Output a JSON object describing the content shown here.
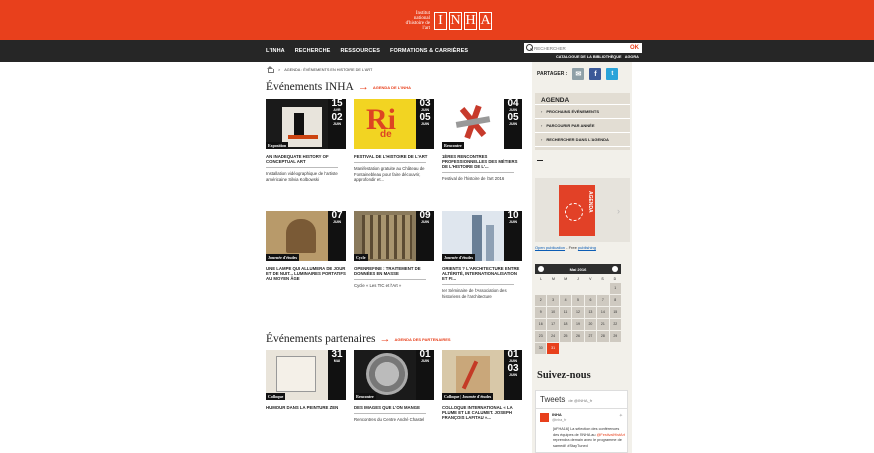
{
  "header": {
    "logo_small": "Institut national d'histoire de l'art",
    "logo_letters": [
      "I",
      "N",
      "H",
      "A"
    ]
  },
  "nav": {
    "items": [
      "L'INHA",
      "RECHERCHE",
      "RESSOURCES",
      "FORMATIONS & CARRIÈRES"
    ],
    "search_placeholder": "RECHERCHER",
    "search_ok": "OK",
    "catalog": "CATALOGUE DE LA BIBLIOTHÈQUE",
    "agora": "AGORA"
  },
  "breadcrumb": "AGENDA : ÉVÉNEMENTS EN HISTOIRE DE L'ART",
  "share_label": "PARTAGER :",
  "inha_section": {
    "title": "Événements INHA",
    "link": "AGENDA DE L'INHA",
    "cards": [
      {
        "d1": "15",
        "m1": "AVR",
        "d2": "02",
        "m2": "JUIN",
        "cat": "Exposition",
        "title": "AN INADEQUATE HISTORY OF CONCEPTUAL ART",
        "desc": "Installation vidéographique de l'artiste américaine Silvia Kolbowski"
      },
      {
        "d1": "03",
        "m1": "JUIN",
        "d2": "05",
        "m2": "JUIN",
        "cat": "",
        "title": "FESTIVAL DE L'HISTOIRE DE L'ART",
        "desc": "Manifestation gratuite au Château de Fontainebleau pour faire découvrir, approfondir et..."
      },
      {
        "d1": "04",
        "m1": "JUIN",
        "d2": "05",
        "m2": "JUIN",
        "cat": "Rencontre",
        "title": "1ÈRES RENCONTRES PROFESSIONNELLES DES MÉTIERS DE L'HISTOIRE DE L'...",
        "desc": "Festival de l'histoire de l'art 2016"
      },
      {
        "d1": "07",
        "m1": "JUIN",
        "d2": "",
        "m2": "",
        "cat": "Journée d'études",
        "title": "UNE LAMPE QUI ALLUMERA DE JOUR ET DE NUIT... LUMINAIRES PORTATIFS AU MOYEN ÂGE",
        "desc": ""
      },
      {
        "d1": "09",
        "m1": "JUIN",
        "d2": "",
        "m2": "",
        "cat": "Cycle",
        "title": "OPENREFINE : TRAITEMENT DE DONNÉES EN MASSE",
        "desc": "Cycle « Les TIC et l'Art »"
      },
      {
        "d1": "10",
        "m1": "JUIN",
        "d2": "",
        "m2": "",
        "cat": "Journée d'études",
        "title": "ORIENTS ? L'ARCHITECTURE ENTRE ALTÉRITÉ, INTERNATIONALISATION ET FI...",
        "desc": "Ier Séminaire de l'Association des historiens de l'architecture"
      }
    ]
  },
  "partner_section": {
    "title": "Événements partenaires",
    "link": "AGENDA DES PARTENAIRES",
    "cards": [
      {
        "d1": "31",
        "m1": "MAI",
        "d2": "",
        "m2": "",
        "cat": "Colloque",
        "title": "HUMOUR DANS LA PEINTURE ZEN",
        "desc": ""
      },
      {
        "d1": "01",
        "m1": "JUIN",
        "d2": "",
        "m2": "",
        "cat": "Rencontre",
        "title": "DES IMAGES QUE L'ON MANGE",
        "desc": "Rencontres du Centre André Chastel"
      },
      {
        "d1": "01",
        "m1": "JUIN",
        "d2": "03",
        "m2": "JUIN",
        "cat": "Colloque | Journée d'études",
        "title": "COLLOQUE INTERNATIONAL « LA PLUME ET LE CALUMET. JOSEPH FRANÇOIS LAFITAU »...",
        "desc": ""
      }
    ]
  },
  "agenda_box": {
    "title": "AGENDA",
    "items": [
      "PROCHAINS ÉVÉNEMENTS",
      "PARCOURIR PAR ANNÉE",
      "RECHERCHER DANS L'AGENDA"
    ]
  },
  "publication": {
    "cover_text": "AGENDA",
    "link_text": "Open publication",
    "free_text": " - Free ",
    "pub_link": "publishing"
  },
  "calendar": {
    "month": "Mai 2016",
    "dow": [
      "L",
      "M",
      "M",
      "J",
      "V",
      "S",
      "D"
    ],
    "days": [
      "",
      "",
      "",
      "",
      "",
      "",
      "1",
      "2",
      "3",
      "4",
      "5",
      "6",
      "7",
      "8",
      "9",
      "10",
      "11",
      "12",
      "13",
      "14",
      "15",
      "16",
      "17",
      "18",
      "19",
      "20",
      "21",
      "22",
      "23",
      "24",
      "25",
      "26",
      "27",
      "28",
      "29",
      "30",
      "31"
    ],
    "today": "31"
  },
  "follow": {
    "title": "Suivez-nous",
    "tweets_title": "Tweets",
    "tweets_by": "de @INHA_fr",
    "user": "INHA",
    "handle": "@inha_fr",
    "tweet_pre": "[#FHA16] La sélection des conférences des équipes de l'INHA au ",
    "tweet_hl": "@FestivalHistArt",
    "tweet_post": " reprendra demain avec le programme de samedi! #StayTuned"
  },
  "colors": {
    "accent": "#e8401c",
    "nav": "#262626",
    "agenda_bg": "#e2ddd3",
    "sidebar": "#f2f0ea"
  }
}
